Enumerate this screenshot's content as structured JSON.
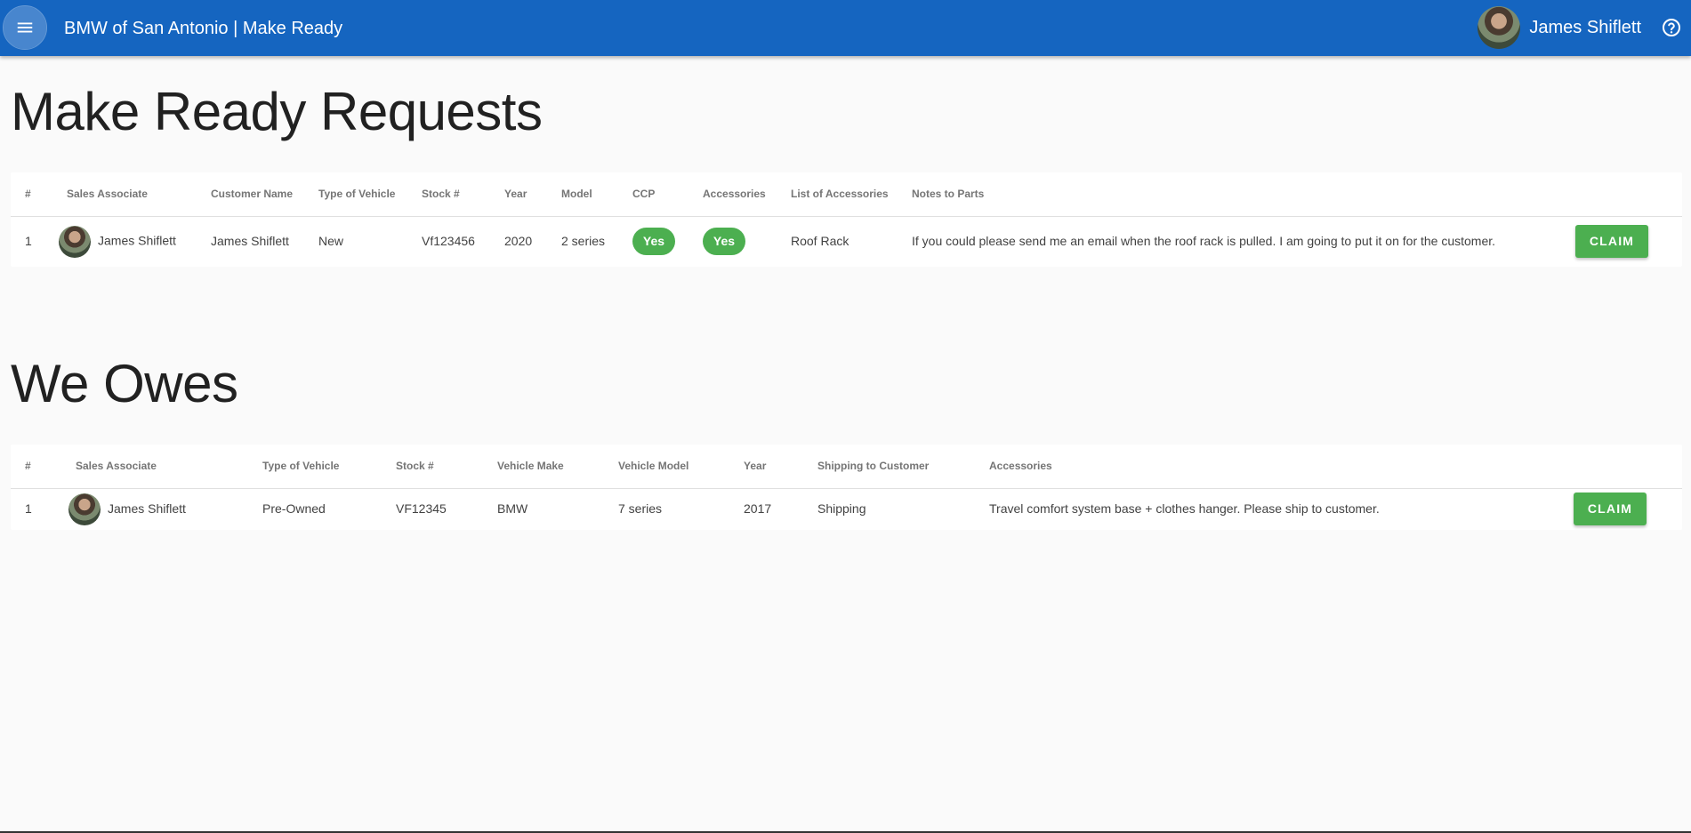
{
  "app": {
    "title": "BMW of San Antonio | Make Ready",
    "user_name": "James Shiflett",
    "colors": {
      "app_bar": "#1565c0",
      "accent_green": "#4caf50",
      "background": "#fafafa"
    },
    "icons": {
      "menu": "menu-icon",
      "help": "help-circle-icon"
    }
  },
  "make_ready": {
    "title": "Make Ready Requests",
    "columns": [
      "#",
      "Sales Associate",
      "Customer Name",
      "Type of Vehicle",
      "Stock #",
      "Year",
      "Model",
      "CCP",
      "Accessories",
      "List of Accessories",
      "Notes to Parts"
    ],
    "rows": [
      {
        "num": "1",
        "sales_associate": "James Shiflett",
        "customer_name": "James Shiflett",
        "type_of_vehicle": "New",
        "stock": "Vf123456",
        "year": "2020",
        "model": "2 series",
        "ccp": "Yes",
        "accessories": "Yes",
        "list_of_accessories": "Roof Rack",
        "notes": "If you could please send me an email when the roof rack is pulled. I am going to put it on for the customer.",
        "action": "CLAIM"
      }
    ]
  },
  "we_owes": {
    "title": "We Owes",
    "columns": [
      "#",
      "Sales Associate",
      "Type of Vehicle",
      "Stock #",
      "Vehicle Make",
      "Vehicle Model",
      "Year",
      "Shipping to Customer",
      "Accessories"
    ],
    "rows": [
      {
        "num": "1",
        "sales_associate": "James Shiflett",
        "type_of_vehicle": "Pre-Owned",
        "stock": "VF12345",
        "make": "BMW",
        "model": "7 series",
        "year": "2017",
        "shipping": "Shipping",
        "accessories": "Travel comfort system base + clothes hanger. Please ship to customer.",
        "action": "CLAIM"
      }
    ]
  }
}
